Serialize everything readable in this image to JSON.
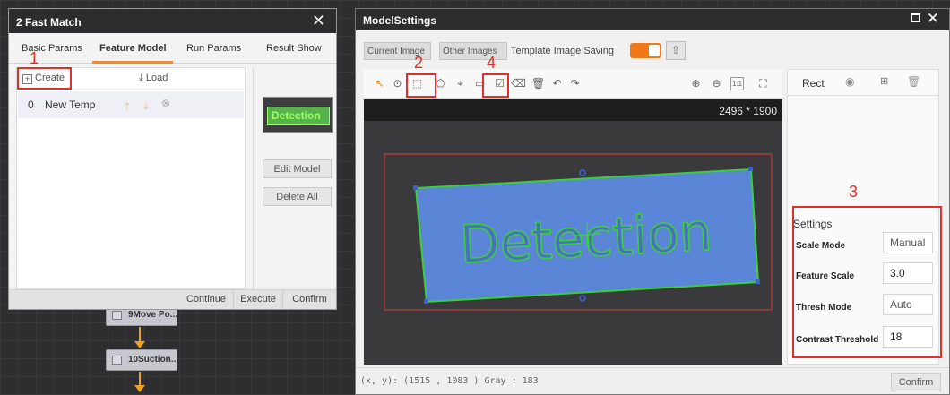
{
  "workspace": {
    "nodes": [
      {
        "label": "9Move Po..."
      },
      {
        "label": "10Suction..."
      }
    ]
  },
  "fast_match": {
    "title": "2 Fast Match",
    "close_icon": "close-icon",
    "tabs": [
      "Basic Params",
      "Feature Model",
      "Run Params",
      "Result Show"
    ],
    "active_tab": "Feature Model",
    "create_label": "Create",
    "load_label": "Load",
    "template_row": {
      "index": "0",
      "name": "New Temp"
    },
    "thumbnail_text": "Detection",
    "edit_model_label": "Edit Model",
    "delete_all_label": "Delete All",
    "continue_label": "Continue",
    "execute_label": "Execute",
    "confirm_label": "Confirm"
  },
  "model_settings": {
    "title": "ModelSettings",
    "current_image_label": "Current Image",
    "other_images_label": "Other Images",
    "template_saving_label": "Template Image Saving",
    "template_saving_on": true,
    "image_dims": "2496 * 1900",
    "detection_text": "Detection",
    "shape_label": "Rect",
    "settings_title": "Settings",
    "settings": [
      {
        "label": "Scale Mode",
        "value": "Manual"
      },
      {
        "label": "Feature Scale",
        "value": "3.0"
      },
      {
        "label": "Thresh Mode",
        "value": "Auto"
      },
      {
        "label": "Contrast Threshold",
        "value": "18"
      }
    ],
    "status_text": "(x, y): (1515 , 1083 ) Gray : 183",
    "confirm_label": "Confirm",
    "accent_color": "#f07a18"
  },
  "annotations": [
    "1",
    "2",
    "3",
    "4"
  ]
}
